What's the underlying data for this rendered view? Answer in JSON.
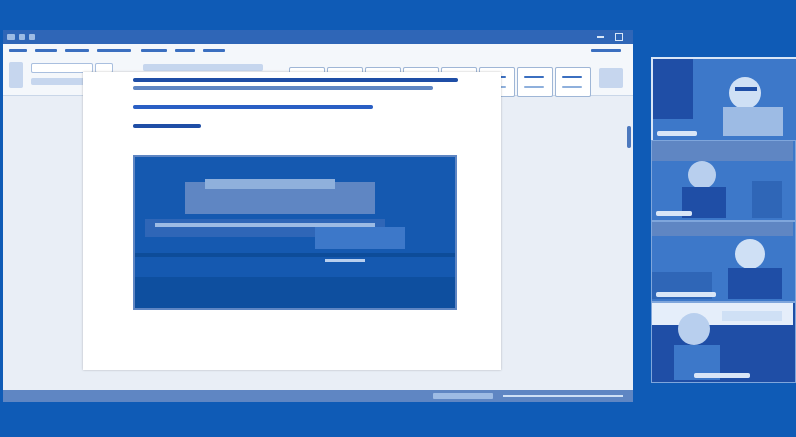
{
  "colors": {
    "background": "#0f5bb6",
    "title_bar": "#2f66b7",
    "ribbon_accent": "#2f66b7",
    "ribbon_text": "#3b6fc0",
    "document_text": "#1f4ea6",
    "document_link": "#2a5fc4",
    "image_tint": "#1559b0",
    "tile_background": "#3d78c9"
  },
  "word_window": {
    "title": "",
    "ribbon_tabs": [
      "",
      "",
      "",
      "",
      "",
      "",
      "",
      ""
    ],
    "style_gallery": [
      "",
      "",
      "",
      "",
      "",
      "",
      "",
      ""
    ],
    "status_bar_text": ""
  },
  "document": {
    "paragraphs": [
      "",
      "",
      ""
    ],
    "image_description_icon": "photo-icon"
  },
  "participants": [
    {
      "name": "",
      "icon": "participant-video-icon"
    },
    {
      "name": "",
      "icon": "participant-video-icon"
    },
    {
      "name": "",
      "icon": "participant-video-icon"
    },
    {
      "name": "",
      "icon": "participant-video-icon"
    }
  ]
}
